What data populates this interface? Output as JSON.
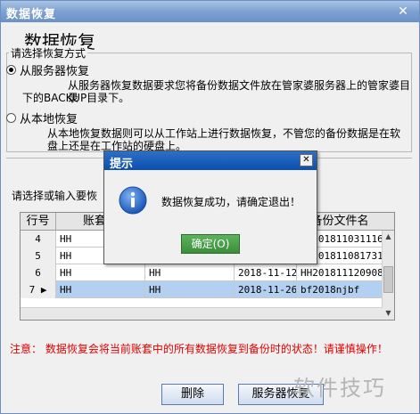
{
  "window": {
    "title": "数据恢复",
    "close_glyph": "✕"
  },
  "heading": "数据恢复",
  "restore_mode": {
    "legend": "请选择恢复方式",
    "server_option": {
      "label": "从服务器恢复",
      "selected": true,
      "desc_line1": "从服务器恢复数据要求您将备份数据文件放在管家婆服务器上的管家婆目录",
      "desc_line2": "下的BACKUP目录下。"
    },
    "local_option": {
      "label": "从本地恢复",
      "selected": false,
      "desc_line1": "从本地恢复数据则可以从工作站上进行数据恢复，不管您的备份数据是在软",
      "desc_line2": "盘上还是在工作站的硬盘上。"
    }
  },
  "select_prompt": "请选择或输入要恢",
  "table": {
    "columns": [
      "行号",
      "账套名",
      "",
      "",
      "备份文件名"
    ],
    "rows": [
      {
        "num": "4",
        "c1": "HH",
        "c2": "",
        "c3": "",
        "file": "HH2018110311163501"
      },
      {
        "num": "5",
        "c1": "HH",
        "c2": "",
        "c3": "",
        "file": "HH2018110817314302"
      },
      {
        "num": "6",
        "c1": "HH",
        "c2": "HH",
        "c3": "2018-11-12",
        "file": "HH201811120908150"
      },
      {
        "num": "7",
        "c1": "HH",
        "c2": "HH",
        "c3": "2018-11-26",
        "file": "bf2018njbf",
        "selected": true,
        "marker": "▶"
      }
    ]
  },
  "note": "注意：  数据恢复会将当前账套中的所有数据恢复到备份时的状态！请谨慎操作！",
  "buttons": {
    "delete": "删除",
    "server_restore": "服务器恢复"
  },
  "watermark": "软件技巧",
  "dialog": {
    "title": "提示",
    "close_glyph": "✕",
    "icon": "info-icon",
    "message": "数据恢复成功，请确定退出！",
    "ok_label": "确定(O)"
  },
  "colors": {
    "note_red": "#e00000",
    "selected_row": "#b3d0f0",
    "dialog_title": "#0b4fb0",
    "ok_green": "#3b8f3b"
  }
}
